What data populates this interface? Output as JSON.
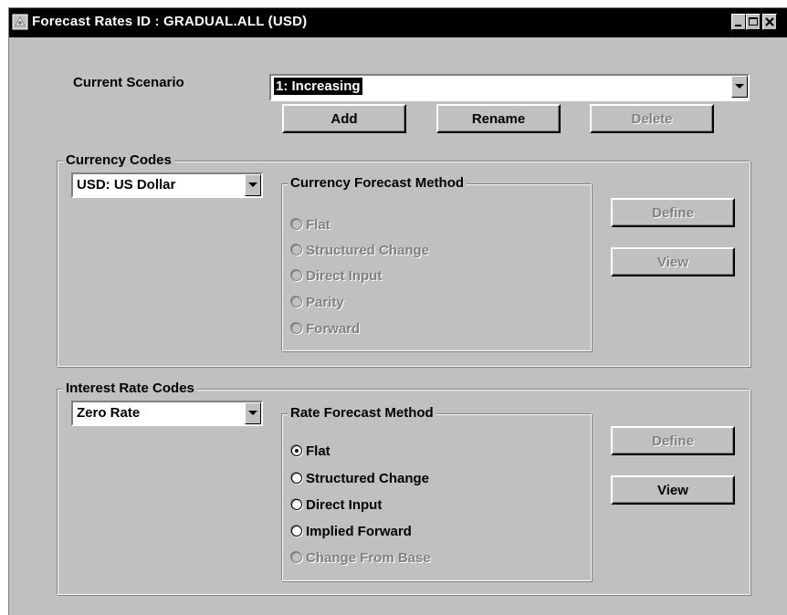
{
  "window": {
    "title": "Forecast Rates ID : GRADUAL.ALL (USD)"
  },
  "scenario": {
    "label": "Current Scenario",
    "selected": "1: Increasing",
    "buttons": {
      "add": "Add",
      "rename": "Rename",
      "delete": "Delete"
    }
  },
  "currency": {
    "group_label": "Currency Codes",
    "selected": "USD: US Dollar",
    "method_group_label": "Currency Forecast Method",
    "methods": [
      {
        "label": "Flat",
        "checked": false,
        "enabled": false
      },
      {
        "label": "Structured Change",
        "checked": false,
        "enabled": false
      },
      {
        "label": "Direct Input",
        "checked": false,
        "enabled": false
      },
      {
        "label": "Parity",
        "checked": false,
        "enabled": false
      },
      {
        "label": "Forward",
        "checked": false,
        "enabled": false
      }
    ],
    "buttons": {
      "define": "Define",
      "view": "View"
    }
  },
  "interest": {
    "group_label": "Interest Rate Codes",
    "selected": "Zero Rate",
    "method_group_label": "Rate Forecast Method",
    "methods": [
      {
        "label": "Flat",
        "checked": true,
        "enabled": true
      },
      {
        "label": "Structured Change",
        "checked": false,
        "enabled": true
      },
      {
        "label": "Direct Input",
        "checked": false,
        "enabled": true
      },
      {
        "label": "Implied Forward",
        "checked": false,
        "enabled": true
      },
      {
        "label": "Change From Base",
        "checked": false,
        "enabled": false
      }
    ],
    "buttons": {
      "define": "Define",
      "view": "View"
    }
  },
  "icons": [
    "app-icon",
    "minimize-icon",
    "maximize-icon",
    "close-icon",
    "dropdown-arrow-icon",
    "radio-icon"
  ],
  "colors": {
    "titlebar": "#000000",
    "face": "#c0c0c0",
    "disabled_text": "#808080"
  }
}
